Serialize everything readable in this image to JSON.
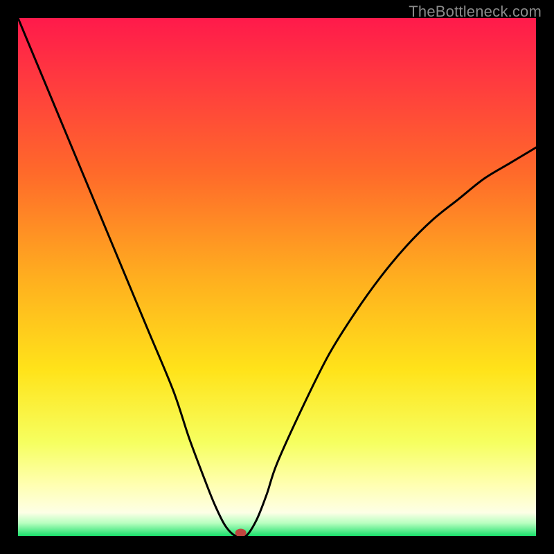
{
  "watermark": "TheBottleneck.com",
  "chart_data": {
    "type": "line",
    "title": "",
    "xlabel": "",
    "ylabel": "",
    "xlim": [
      0,
      100
    ],
    "ylim": [
      0,
      100
    ],
    "x": [
      0,
      5,
      10,
      15,
      20,
      25,
      30,
      33,
      36,
      38,
      40,
      42,
      44,
      46,
      48,
      50,
      55,
      60,
      65,
      70,
      75,
      80,
      85,
      90,
      95,
      100
    ],
    "values": [
      100,
      88,
      76,
      64,
      52,
      40,
      28,
      19,
      11,
      6,
      2,
      0,
      0,
      3,
      8,
      14,
      25,
      35,
      43,
      50,
      56,
      61,
      65,
      69,
      72,
      75
    ],
    "marker": {
      "x": 43,
      "y": 0.6
    },
    "gradient_stops": [
      {
        "offset": 0.0,
        "color": "#ff1a4b"
      },
      {
        "offset": 0.12,
        "color": "#ff3a3f"
      },
      {
        "offset": 0.3,
        "color": "#ff6a2a"
      },
      {
        "offset": 0.5,
        "color": "#ffae1f"
      },
      {
        "offset": 0.68,
        "color": "#ffe31a"
      },
      {
        "offset": 0.82,
        "color": "#f6ff60"
      },
      {
        "offset": 0.9,
        "color": "#ffffb0"
      },
      {
        "offset": 0.955,
        "color": "#fdffe6"
      },
      {
        "offset": 0.975,
        "color": "#b8ffc0"
      },
      {
        "offset": 1.0,
        "color": "#1adf6b"
      }
    ]
  }
}
